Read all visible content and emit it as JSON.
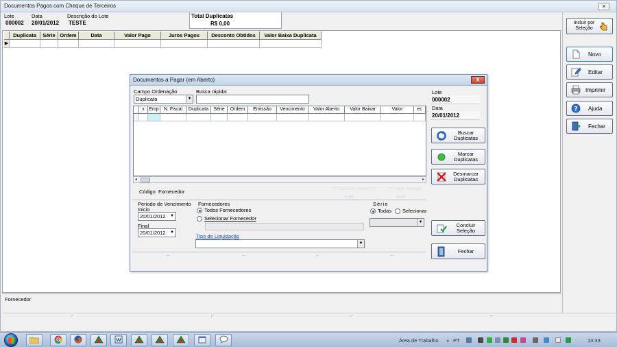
{
  "main_window": {
    "title": "Documentos Pagos com Cheque de Terceiros",
    "close": "✕"
  },
  "header": {
    "lote_label": "Lote",
    "lote_value": "000002",
    "data_label": "Data",
    "data_value": "20/01/2012",
    "descricao_label": "Descrição do Lote",
    "descricao_value": "TESTE",
    "total_label": "Total Duplicatas",
    "total_value": "R$ 0,00"
  },
  "main_grid": {
    "columns": [
      "Duplicata",
      "Série",
      "Ordem",
      "Data",
      "Valor Pago",
      "Juros Pagos",
      "Desconto Obtidos",
      "Valor Baixa Duplicata"
    ],
    "row_indicator": "▶"
  },
  "footer": {
    "fornecedor_label": "Fornecedor"
  },
  "side_buttons": {
    "incluir": "Incluir por Seleção",
    "novo": "Novo",
    "editar": "Editar",
    "imprimir": "Imprimir",
    "ajuda": "Ajuda",
    "fechar": "Fechar"
  },
  "dialog": {
    "title": "Documentos a Pagar (em Aberto)",
    "close": "X",
    "campo_ordenacao_label": "Campo Ordenação",
    "campo_ordenacao_value": "Duplicata",
    "busca_label": "Busca rápida:",
    "busca_value": "",
    "grid_columns": [
      "",
      "x",
      "Emp",
      "N. Fiscal",
      "Duplicata",
      "Série",
      "Ordem",
      "Emissão",
      "Vencimento",
      "Valor Aberto",
      "Valor Baixar",
      "Valor",
      "ec"
    ],
    "codigo_label": "Código",
    "fornecedor_label": "Fornecedor",
    "ghost_total_aberto": "*** Total em Aberto ***",
    "ghost_total_selecao": "*** Valor Seleção",
    "ghost_val1": "0,00",
    "ghost_val2": "0,00",
    "periodo_label": "Periodo de Vencimento",
    "inicio_label": "Inicio",
    "inicio_value": "20/01/2012",
    "final_label": "Final",
    "final_value": "20/01/2012",
    "fornecedores_label": "Fornecedores",
    "todos_fornecedores": "Todos Fornecedores",
    "selecionar_fornecedor": "Selecionar Fornecedor",
    "tipo_liquidacao_label": "Tipo de Liquidação",
    "tipo_liquidacao_value": "",
    "serie_label": "Série",
    "serie_todas": "Todas",
    "serie_selecionar": "Selecionar",
    "lote_label": "Lote",
    "lote_value": "000002",
    "data_label": "Data",
    "data_value": "20/01/2012",
    "buscar": "Buscar Duplicatas",
    "marcar": "Marcar Duplicatas",
    "desmarcar": "Desmarcar Duplicatas",
    "concluir": "Concluir Seleção",
    "fechar": "Fechar"
  },
  "taskbar": {
    "area_trabalho": "Área de Trabalho",
    "lang": "PT",
    "clock": "13:33"
  }
}
